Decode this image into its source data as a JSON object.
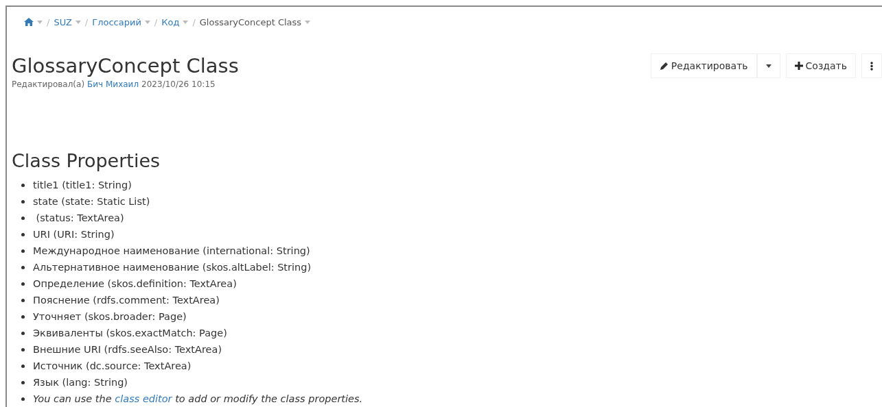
{
  "breadcrumb": [
    {
      "kind": "home"
    },
    {
      "kind": "link",
      "separator": "/",
      "label": "SUZ"
    },
    {
      "kind": "link",
      "separator": "/",
      "label": "Глоссарий"
    },
    {
      "kind": "link",
      "separator": "/",
      "label": "Код"
    },
    {
      "kind": "current",
      "separator": "/",
      "label": "GlossaryConcept Class"
    }
  ],
  "title": "GlossaryConcept Class",
  "meta": {
    "prefix": "Редактировал(а)",
    "author": "Бич Михаил",
    "date": "2023/10/26 10:15"
  },
  "actions": {
    "edit": "Редактировать",
    "create": "Создать"
  },
  "section_title": "Class Properties",
  "properties": [
    "title1 (title1: String)",
    "state (state: Static List)",
    " (status: TextArea)",
    "URI (URI: String)",
    "Международное наименование (international: String)",
    "Альтернативное наименование (skos.altLabel: String)",
    "Определение (skos.definition: TextArea)",
    "Пояснение (rdfs.comment: TextArea)",
    "Уточняет (skos.broader: Page)",
    "Эквиваленты (skos.exactMatch: Page)",
    "Внешние URI (rdfs.seeAlso: TextArea)",
    "Источник (dc.source: TextArea)",
    "Язык (lang: String)"
  ],
  "hint": {
    "before": "You can use the",
    "link": "class editor",
    "after": "to add or modify the class properties."
  }
}
